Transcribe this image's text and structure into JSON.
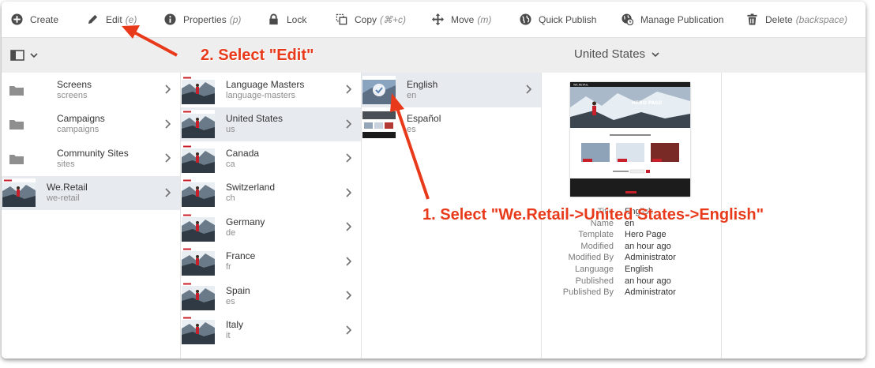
{
  "toolbar": {
    "create": {
      "label": "Create"
    },
    "edit": {
      "label": "Edit",
      "hint": "(e)"
    },
    "properties": {
      "label": "Properties",
      "hint": "(p)"
    },
    "lock": {
      "label": "Lock"
    },
    "copy": {
      "label": "Copy",
      "hint": "(⌘+c)"
    },
    "move": {
      "label": "Move",
      "hint": "(m)"
    },
    "quick_publish": {
      "label": "Quick Publish"
    },
    "manage_publication": {
      "label": "Manage Publication"
    },
    "delete": {
      "label": "Delete",
      "hint": "(backspace)"
    }
  },
  "header": {
    "location": "United States"
  },
  "column1": [
    {
      "name": "Screens",
      "sub": "screens",
      "kind": "folder"
    },
    {
      "name": "Campaigns",
      "sub": "campaigns",
      "kind": "folder"
    },
    {
      "name": "Community Sites",
      "sub": "sites",
      "kind": "folder"
    },
    {
      "name": "We.Retail",
      "sub": "we-retail",
      "kind": "page",
      "selected": true
    }
  ],
  "column2": [
    {
      "name": "Language Masters",
      "sub": "language-masters"
    },
    {
      "name": "United States",
      "sub": "us",
      "selected": true
    },
    {
      "name": "Canada",
      "sub": "ca"
    },
    {
      "name": "Switzerland",
      "sub": "ch"
    },
    {
      "name": "Germany",
      "sub": "de"
    },
    {
      "name": "France",
      "sub": "fr"
    },
    {
      "name": "Spain",
      "sub": "es"
    },
    {
      "name": "Italy",
      "sub": "it"
    }
  ],
  "column3": [
    {
      "name": "English",
      "sub": "en",
      "selected": true,
      "checked": true
    },
    {
      "name": "Español",
      "sub": "es"
    }
  ],
  "details": {
    "preview_logo": "WE.RETAIL",
    "preview_title": "HERO PAGE",
    "rows": [
      {
        "label": "Title",
        "value": "English"
      },
      {
        "label": "Name",
        "value": "en"
      },
      {
        "label": "Template",
        "value": "Hero Page"
      },
      {
        "label": "Modified",
        "value": "an hour ago"
      },
      {
        "label": "Modified By",
        "value": "Administrator"
      },
      {
        "label": "Language",
        "value": "English"
      },
      {
        "label": "Published",
        "value": "an hour ago"
      },
      {
        "label": "Published By",
        "value": "Administrator"
      }
    ]
  },
  "annotations": {
    "step1": "1. Select \"We.Retail->United States->English\"",
    "step2": "2. Select \"Edit\""
  },
  "colors": {
    "accent": "#e83a1a",
    "selected_row": "#e7ebf0",
    "header": "#eeeeee"
  }
}
